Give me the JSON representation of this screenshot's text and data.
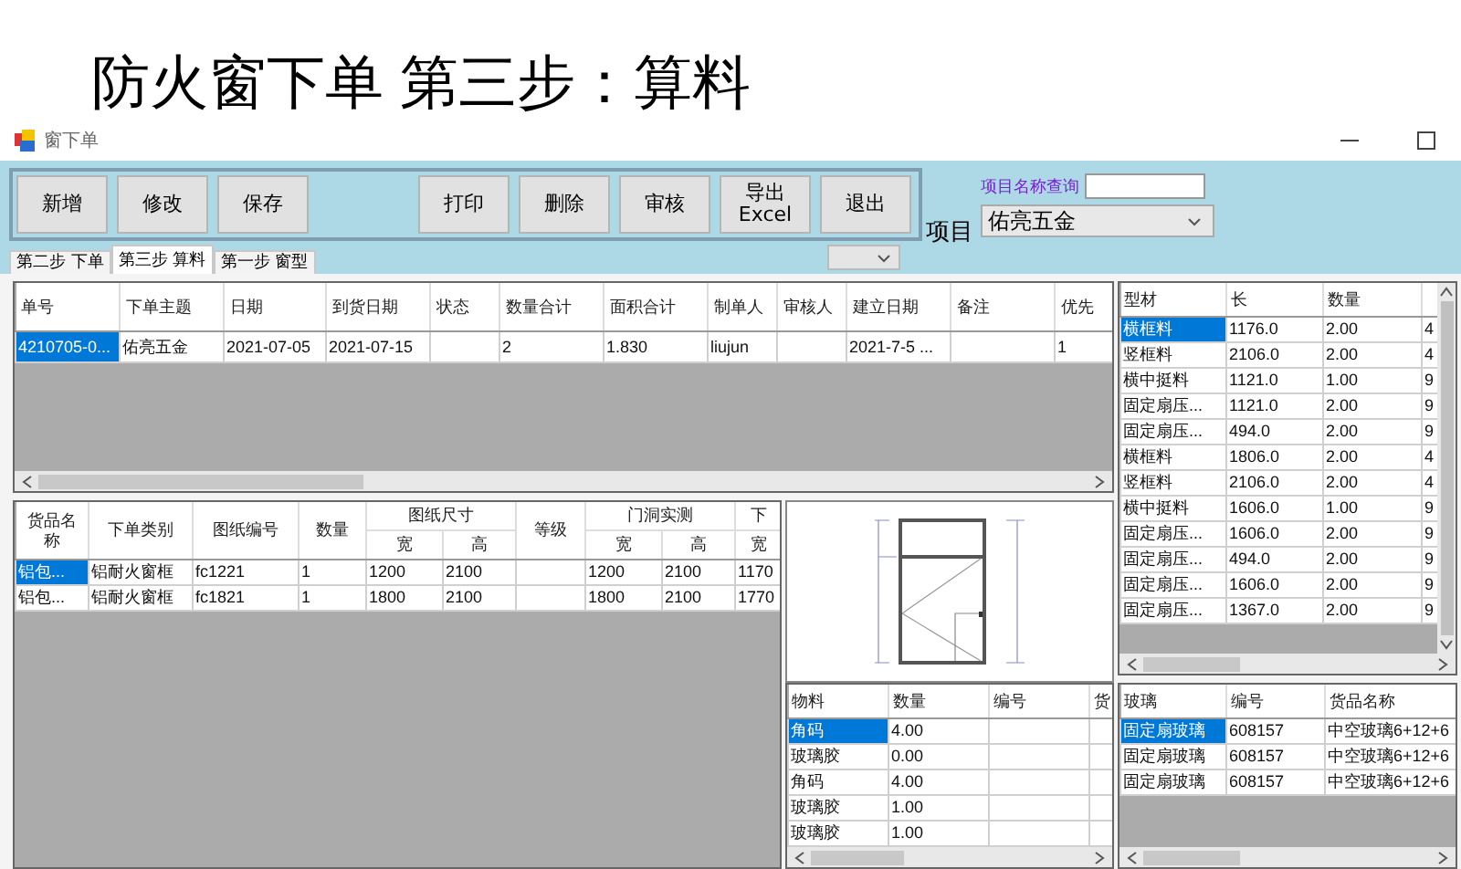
{
  "slide_title": "防火窗下单 第三步：算料",
  "window": {
    "title": "窗下单"
  },
  "toolbar": {
    "groups": [
      [
        {
          "label": "新增"
        },
        {
          "label": "修改"
        },
        {
          "label": "保存"
        }
      ],
      [
        {
          "label": "打印"
        },
        {
          "label": "删除"
        },
        {
          "label": "审核"
        },
        {
          "label": "导出\nExcel"
        },
        {
          "label": "退出"
        }
      ]
    ]
  },
  "search": {
    "label": "项目名称查询"
  },
  "project": {
    "label": "项目",
    "value": "佑亮五金"
  },
  "tabs": [
    {
      "label": "第二步 下单",
      "selected": false
    },
    {
      "label": "第三步 算料",
      "selected": true
    },
    {
      "label": "第一步 窗型",
      "selected": false
    }
  ],
  "orders": {
    "columns": [
      "单号",
      "下单主题",
      "日期",
      "到货日期",
      "状态",
      "数量合计",
      "面积合计",
      "制单人",
      "审核人",
      "建立日期",
      "备注",
      "优先"
    ],
    "rows": [
      {
        "selected": true,
        "cells": [
          "4210705-0...",
          "佑亮五金",
          "2021-07-05",
          "2021-07-15",
          null,
          "2",
          "1.830",
          "liujun",
          null,
          "2021-7-5 ...",
          null,
          "1"
        ]
      }
    ]
  },
  "items": {
    "columns": [
      {
        "label": "货品名称"
      },
      {
        "label": "下单类别"
      },
      {
        "label": "图纸编号"
      },
      {
        "label": "数量"
      },
      {
        "label": "图纸尺寸",
        "colspan": 2,
        "sub": [
          "宽",
          "高"
        ]
      },
      {
        "label": "等级"
      },
      {
        "label": "门洞实测",
        "colspan": 2,
        "sub": [
          "宽",
          "高"
        ]
      },
      {
        "label": "下",
        "sub": [
          "宽"
        ]
      }
    ],
    "rows": [
      {
        "selected": true,
        "cells": [
          "铝包...",
          "铝耐火窗框",
          "fc1221",
          "1",
          "1200",
          "2100",
          null,
          "1200",
          "2100",
          "1170"
        ]
      },
      {
        "selected": false,
        "cells": [
          "铝包...",
          "铝耐火窗框",
          "fc1821",
          "1",
          "1800",
          "2100",
          null,
          "1800",
          "2100",
          "1770"
        ]
      }
    ]
  },
  "profiles": {
    "columns": [
      "型材",
      "长",
      "数量"
    ],
    "rows": [
      {
        "selected": true,
        "cells": [
          "横框料",
          "1176.0",
          "2.00",
          "4"
        ]
      },
      {
        "selected": false,
        "cells": [
          "竖框料",
          "2106.0",
          "2.00",
          "4"
        ]
      },
      {
        "selected": false,
        "cells": [
          "横中挺料",
          "1121.0",
          "1.00",
          "9"
        ]
      },
      {
        "selected": false,
        "cells": [
          "固定扇压...",
          "1121.0",
          "2.00",
          "9"
        ]
      },
      {
        "selected": false,
        "cells": [
          "固定扇压...",
          "494.0",
          "2.00",
          "9"
        ]
      },
      {
        "selected": false,
        "cells": [
          "横框料",
          "1806.0",
          "2.00",
          "4"
        ]
      },
      {
        "selected": false,
        "cells": [
          "竖框料",
          "2106.0",
          "2.00",
          "4"
        ]
      },
      {
        "selected": false,
        "cells": [
          "横中挺料",
          "1606.0",
          "1.00",
          "9"
        ]
      },
      {
        "selected": false,
        "cells": [
          "固定扇压...",
          "1606.0",
          "2.00",
          "9"
        ]
      },
      {
        "selected": false,
        "cells": [
          "固定扇压...",
          "494.0",
          "2.00",
          "9"
        ]
      },
      {
        "selected": false,
        "cells": [
          "固定扇压...",
          "1606.0",
          "2.00",
          "9"
        ]
      },
      {
        "selected": false,
        "cells": [
          "固定扇压...",
          "1367.0",
          "2.00",
          "9"
        ]
      }
    ]
  },
  "accessories": {
    "columns": [
      "物料",
      "数量",
      "编号",
      "货"
    ],
    "rows": [
      {
        "selected": true,
        "cells": [
          "角码",
          "4.00",
          null,
          null
        ]
      },
      {
        "selected": false,
        "cells": [
          "玻璃胶",
          "0.00",
          null,
          null
        ]
      },
      {
        "selected": false,
        "cells": [
          "角码",
          "4.00",
          null,
          null
        ]
      },
      {
        "selected": false,
        "cells": [
          "玻璃胶",
          "1.00",
          null,
          null
        ]
      },
      {
        "selected": false,
        "cells": [
          "玻璃胶",
          "1.00",
          null,
          null
        ]
      }
    ]
  },
  "glass": {
    "columns": [
      "玻璃",
      "编号",
      "货品名称"
    ],
    "rows": [
      {
        "selected": true,
        "cells": [
          "固定扇玻璃",
          "608157",
          "中空玻璃6+12+6"
        ]
      },
      {
        "selected": false,
        "cells": [
          "固定扇玻璃",
          "608157",
          "中空玻璃6+12+6"
        ]
      },
      {
        "selected": false,
        "cells": [
          "固定扇玻璃",
          "608157",
          "中空玻璃6+12+6"
        ]
      }
    ]
  }
}
